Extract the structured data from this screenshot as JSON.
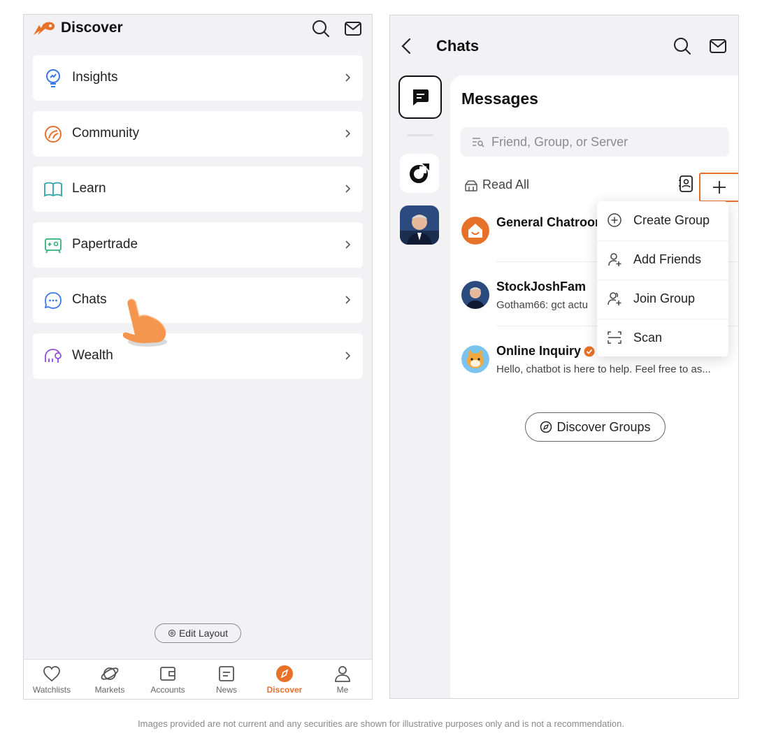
{
  "left_screen": {
    "title": "Discover",
    "menu_items": [
      {
        "label": "Insights",
        "icon": "lightbulb-icon"
      },
      {
        "label": "Community",
        "icon": "community-icon"
      },
      {
        "label": "Learn",
        "icon": "book-icon"
      },
      {
        "label": "Papertrade",
        "icon": "gamepad-icon"
      },
      {
        "label": "Chats",
        "icon": "chat-bubble-icon"
      },
      {
        "label": "Wealth",
        "icon": "piggy-bank-icon"
      }
    ],
    "edit_layout_label": "Edit Layout",
    "bottom_nav": [
      {
        "label": "Watchlists",
        "icon": "heart-icon"
      },
      {
        "label": "Markets",
        "icon": "planet-icon"
      },
      {
        "label": "Accounts",
        "icon": "wallet-icon"
      },
      {
        "label": "News",
        "icon": "news-icon"
      },
      {
        "label": "Discover",
        "icon": "compass-icon",
        "active": true
      },
      {
        "label": "Me",
        "icon": "person-icon"
      }
    ]
  },
  "right_screen": {
    "title": "Chats",
    "messages_title": "Messages",
    "search_placeholder": "Friend, Group, or Server",
    "read_all_label": "Read All",
    "chats": [
      {
        "name": "General Chatroom",
        "preview": ""
      },
      {
        "name": "StockJoshFam",
        "preview": "Gotham66: gct actu"
      },
      {
        "name": "Online Inquiry",
        "preview": "Hello, chatbot is here to help. Feel free to as..."
      }
    ],
    "discover_groups_label": "Discover Groups",
    "dropdown": [
      {
        "label": "Create Group",
        "icon": "plus-circle-icon"
      },
      {
        "label": "Add Friends",
        "icon": "add-friend-icon"
      },
      {
        "label": "Join Group",
        "icon": "join-group-icon"
      },
      {
        "label": "Scan",
        "icon": "scan-icon"
      }
    ]
  },
  "disclaimer": "Images provided are not current and any securities are shown for illustrative purposes only and is not a recommendation.",
  "colors": {
    "accent": "#e8712a",
    "background": "#f2f2f4",
    "card": "#ffffff",
    "text": "#1a1a1a"
  }
}
